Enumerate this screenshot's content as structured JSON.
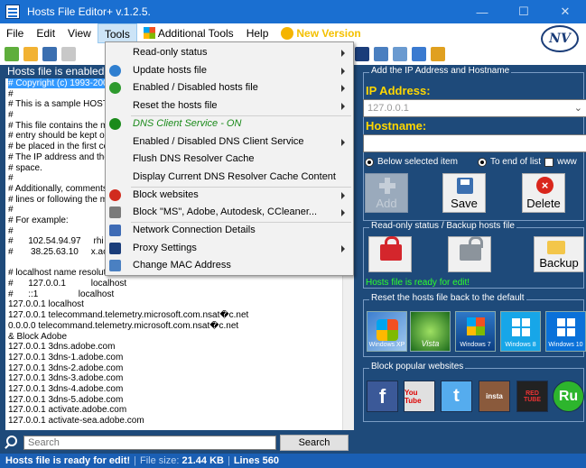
{
  "window": {
    "title": "Hosts File Editor+ v.1.2.5.",
    "controls": {
      "minimize": "—",
      "maximize": "☐",
      "close": "✕"
    }
  },
  "menubar": {
    "items": [
      "File",
      "Edit",
      "View",
      "Tools",
      "Additional Tools",
      "Help",
      "New Version"
    ]
  },
  "tools_menu": {
    "items": [
      {
        "label": "Read-only status",
        "submenu": true,
        "icon": "none"
      },
      {
        "label": "Update hosts file",
        "submenu": true,
        "icon": "globe-icon"
      },
      {
        "label": "Enabled / Disabled hosts file",
        "submenu": true,
        "icon": "power-icon"
      },
      {
        "label": "Reset the hosts file",
        "submenu": true,
        "icon": "none"
      },
      {
        "label": "DNS Client Service - ON",
        "submenu": false,
        "icon": "power-on-icon",
        "special": true
      },
      {
        "label": "Enabled / Disabled DNS Client Service",
        "submenu": true,
        "icon": "none"
      },
      {
        "label": "Flush DNS Resolver Cache",
        "submenu": false,
        "icon": "none"
      },
      {
        "label": "Display Current DNS Resolver Cache Content",
        "submenu": false,
        "icon": "none"
      },
      {
        "label": "Block websites",
        "submenu": true,
        "icon": "hand-icon"
      },
      {
        "label": "Block \"MS\", Adobe, Autodesk, CCleaner...",
        "submenu": true,
        "icon": "shield-icon"
      },
      {
        "label": "Network Connection Details",
        "submenu": false,
        "icon": "network-icon"
      },
      {
        "label": "Proxy Settings",
        "submenu": true,
        "icon": "proxy-icon"
      },
      {
        "label": "Change MAC Address",
        "submenu": false,
        "icon": "mac-icon"
      }
    ]
  },
  "left": {
    "status": "Hosts file is enabled.",
    "lines": [
      "# Copyright (c) 1993-200",
      "#",
      "# This is a sample HOST",
      "#",
      "# This file contains the m",
      "# entry should be kept on",
      "# be placed in the first co",
      "# The IP address and the",
      "# space.",
      "#",
      "# Additionally, comments",
      "# lines or following the m",
      "#",
      "# For example:",
      "#",
      "#      102.54.94.97     rhi",
      "#       38.25.63.10     x.ac",
      "",
      "# localhost name resolution is handled within DNS itself.",
      "#      127.0.0.1          localhost",
      "#      ::1                localhost",
      "127.0.0.1 localhost",
      "127.0.0.1 telecommand.telemetry.microsoft.com.nsat�c.net",
      "0.0.0.0 telecommand.telemetry.microsoft.com.nsat�c.net",
      "& Block Adobe",
      "127.0.0.1 3dns.adobe.com",
      "127.0.0.1 3dns-1.adobe.com",
      "127.0.0.1 3dns-2.adobe.com",
      "127.0.0.1 3dns-3.adobe.com",
      "127.0.0.1 3dns-4.adobe.com",
      "127.0.0.1 3dns-5.adobe.com",
      "127.0.0.1 activate.adobe.com",
      "127.0.0.1 activate-sea.adobe.com"
    ],
    "search_placeholder": "Search",
    "search_button": "Search"
  },
  "right": {
    "add_group_title": "Add the IP Address  and Hostname",
    "ip_label": "IP Address:",
    "ip_value": "127.0.0.1",
    "hostname_label": "Hostname:",
    "hostname_value": "",
    "radio_below": "Below selected item",
    "radio_end": "To end of list",
    "www_label": "www",
    "btn_add": "Add",
    "btn_save": "Save",
    "btn_delete": "Delete",
    "readonly_group_title": "Read-only status / Backup hosts file",
    "btn_backup": "Backup",
    "ready_text": "Hosts file is ready for edit!",
    "reset_group_title": "Reset the hosts file back to the default",
    "os_buttons": [
      "Windows XP",
      "Vista",
      "Windows 7",
      "Windows 8",
      "Windows 10"
    ],
    "block_group_title": "Block popular websites",
    "sites": [
      "f",
      "You Tube",
      "t",
      "insta",
      "RED TUBE",
      "Ru"
    ]
  },
  "statusbar": {
    "ready": "Hosts file is ready for edit!",
    "file_size_label": "File size:",
    "file_size": "21.44 KB",
    "lines": "Lines 560"
  },
  "colors": {
    "titlebar": "#1a6fd1",
    "panel": "#1e4a7a",
    "ip_label": "#ffd700",
    "ready": "#2dff2d",
    "dns_on": "#1a8a1a"
  }
}
